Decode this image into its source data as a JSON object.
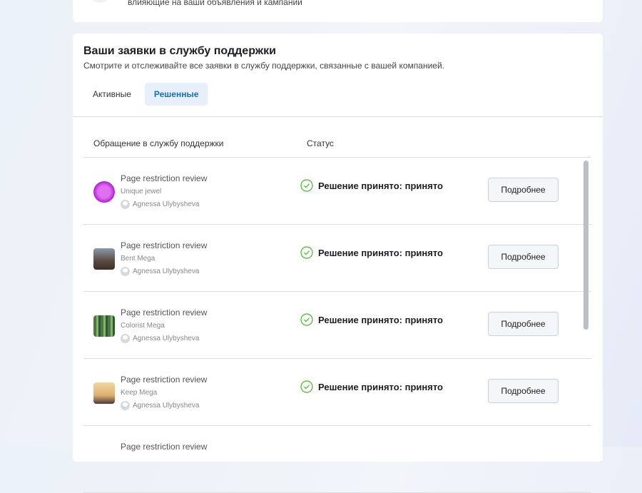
{
  "top_card": {
    "text": "влияющие на ваши объявления и кампании"
  },
  "header": {
    "title": "Ваши заявки в службу поддержки",
    "subtitle": "Смотрите и отслеживайте все заявки в службу поддержки, связанные с вашей компанией."
  },
  "tabs": [
    {
      "label": "Активные",
      "active": false
    },
    {
      "label": "Решенные",
      "active": true
    }
  ],
  "table": {
    "columns": [
      "Обращение в службу поддержки",
      "Статус"
    ],
    "rows": [
      {
        "title": "Page restriction review",
        "page": "Unique jewel",
        "user": "Agnessa Ulybysheva",
        "status": "Решение принято: принято",
        "button": "Подробнее"
      },
      {
        "title": "Page restriction review",
        "page": "Bent Mega",
        "user": "Agnessa Ulybysheva",
        "status": "Решение принято: принято",
        "button": "Подробнее"
      },
      {
        "title": "Page restriction review",
        "page": "Colorist Mega",
        "user": "Agnessa Ulybysheva",
        "status": "Решение принято: принято",
        "button": "Подробнее"
      },
      {
        "title": "Page restriction review",
        "page": "Keep Mega",
        "user": "Agnessa Ulybysheva",
        "status": "Решение принято: принято",
        "button": "Подробнее"
      },
      {
        "title": "Page restriction review"
      }
    ]
  },
  "colors": {
    "accent": "#1a6fb0",
    "success": "#42b72a"
  }
}
